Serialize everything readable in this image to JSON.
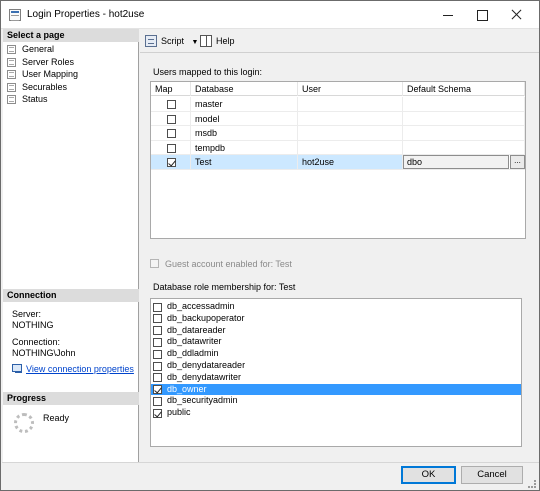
{
  "window": {
    "title": "Login Properties - hot2use"
  },
  "left_pane": {
    "select_page_header": "Select a page",
    "pages": [
      "General",
      "Server Roles",
      "User Mapping",
      "Securables",
      "Status"
    ],
    "connection_header": "Connection",
    "server_label": "Server:",
    "server_value": "NOTHING",
    "connection_label": "Connection:",
    "connection_value": "NOTHING\\John",
    "view_connection_link": "View connection properties",
    "progress_header": "Progress",
    "progress_status": "Ready"
  },
  "toolbar": {
    "script_label": "Script",
    "help_label": "Help"
  },
  "users_mapped": {
    "label": "Users mapped to this login:",
    "columns": [
      "Map",
      "Database",
      "User",
      "Default Schema"
    ],
    "rows": [
      {
        "map": false,
        "database": "master",
        "user": "",
        "schema": ""
      },
      {
        "map": false,
        "database": "model",
        "user": "",
        "schema": ""
      },
      {
        "map": false,
        "database": "msdb",
        "user": "",
        "schema": ""
      },
      {
        "map": false,
        "database": "tempdb",
        "user": "",
        "schema": ""
      },
      {
        "map": true,
        "database": "Test",
        "user": "hot2use",
        "schema": "dbo",
        "selected": true
      }
    ],
    "browse_button": "..."
  },
  "guest_account": {
    "label": "Guest account enabled for: Test",
    "enabled": false
  },
  "roles": {
    "label": "Database role membership for: Test",
    "items": [
      {
        "name": "db_accessadmin",
        "checked": false
      },
      {
        "name": "db_backupoperator",
        "checked": false
      },
      {
        "name": "db_datareader",
        "checked": false
      },
      {
        "name": "db_datawriter",
        "checked": false
      },
      {
        "name": "db_ddladmin",
        "checked": false
      },
      {
        "name": "db_denydatareader",
        "checked": false
      },
      {
        "name": "db_denydatawriter",
        "checked": false
      },
      {
        "name": "db_owner",
        "checked": true,
        "selected": true
      },
      {
        "name": "db_securityadmin",
        "checked": false
      },
      {
        "name": "public",
        "checked": true
      }
    ]
  },
  "buttons": {
    "ok": "OK",
    "cancel": "Cancel"
  },
  "colors": {
    "selection_highlight": "#3399ff",
    "row_highlight": "#cce8ff",
    "link": "#0044cc",
    "default_button_border": "#0078d7"
  }
}
